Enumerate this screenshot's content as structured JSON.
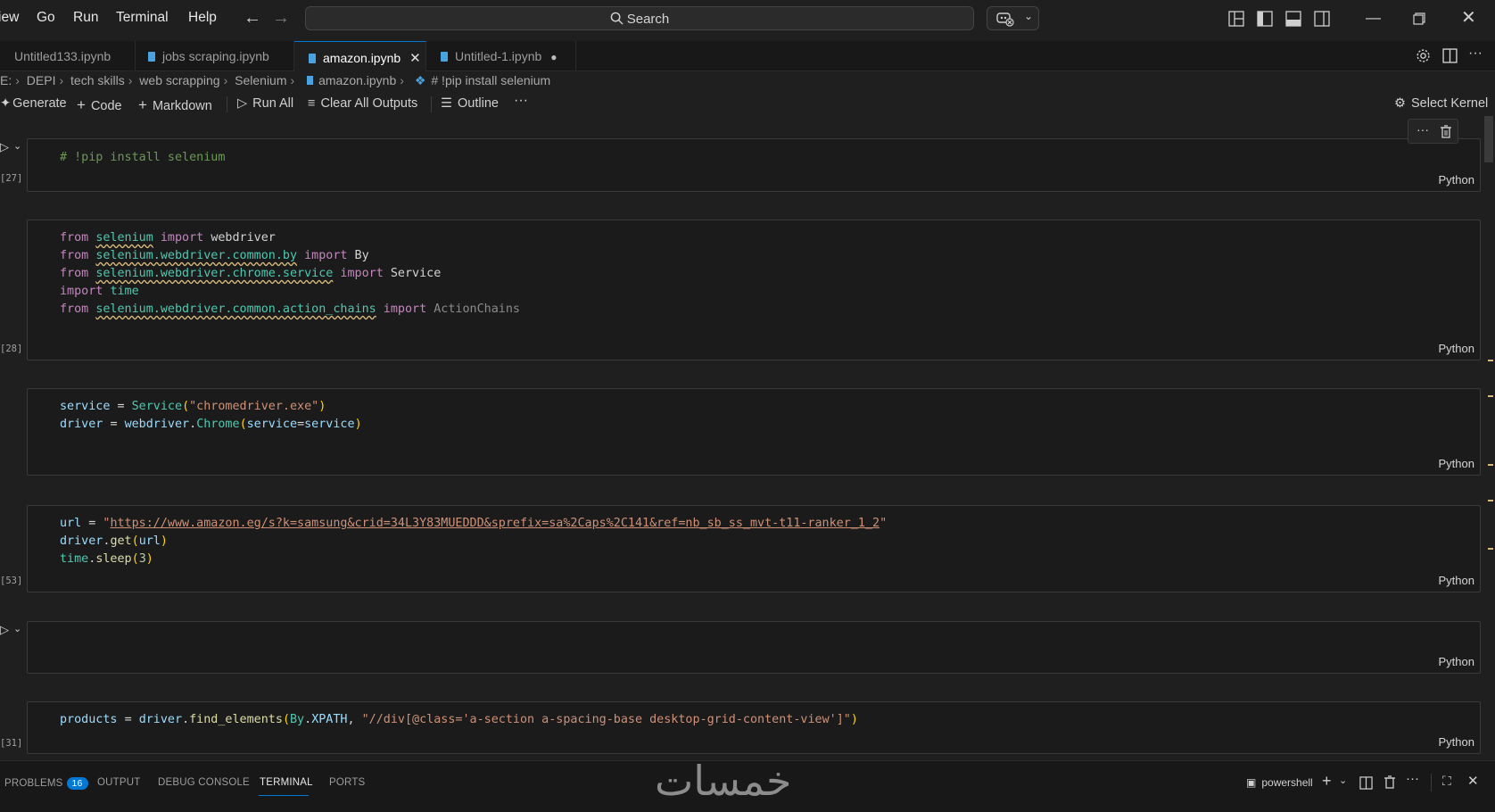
{
  "menu": [
    "iew",
    "Go",
    "Run",
    "Terminal",
    "Help"
  ],
  "search": {
    "label": "Search"
  },
  "tabs": [
    {
      "label": "Untitled133.ipynb",
      "active": false,
      "modified": false
    },
    {
      "label": "jobs scraping.ipynb",
      "active": false,
      "modified": false
    },
    {
      "label": "amazon.ipynb",
      "active": true,
      "modified": false
    },
    {
      "label": "Untitled-1.ipynb",
      "active": false,
      "modified": true
    }
  ],
  "breadcrumb": [
    "E:",
    "DEPI",
    "tech skills",
    "web scrapping",
    "Selenium",
    "amazon.ipynb",
    "# !pip install selenium"
  ],
  "notebook_toolbar": {
    "generate": "Generate",
    "code": "Code",
    "markdown": "Markdown",
    "run_all": "Run All",
    "clear_all": "Clear All Outputs",
    "outline": "Outline",
    "more": "···",
    "select_kernel": "Select Kernel"
  },
  "cells": [
    {
      "exec": "[27]",
      "lang": "Python",
      "lines": [
        "# !pip install selenium"
      ]
    },
    {
      "exec": "[28]",
      "lang": "Python",
      "lines": [
        "from selenium import webdriver",
        "from selenium.webdriver.common.by import By",
        "from selenium.webdriver.chrome.service import Service",
        "import time",
        "from selenium.webdriver.common.action_chains import ActionChains"
      ]
    },
    {
      "exec": "",
      "lang": "Python",
      "lines": [
        "service = Service(\"chromedriver.exe\")",
        "driver = webdriver.Chrome(service=service)"
      ]
    },
    {
      "exec": "[53]",
      "lang": "Python",
      "lines": [
        "url = \"https://www.amazon.eg/s?k=samsung&crid=34L3Y83MUEDDD&sprefix=sa%2Caps%2C141&ref=nb_sb_ss_mvt-t11-ranker_1_2\"",
        "driver.get(url)",
        "time.sleep(3)"
      ]
    },
    {
      "exec": "",
      "lang": "Python",
      "lines": []
    },
    {
      "exec": "[31]",
      "lang": "Python",
      "lines": [
        "products = driver.find_elements(By.XPATH, \"//div[@class='a-section a-spacing-base desktop-grid-content-view']\")"
      ]
    }
  ],
  "panel": {
    "tabs": [
      "PROBLEMS",
      "OUTPUT",
      "DEBUG CONSOLE",
      "TERMINAL",
      "PORTS"
    ],
    "problems_count": "16",
    "active_tab": "TERMINAL",
    "terminal_name": "powershell"
  },
  "watermark": "خمسات",
  "colors": {
    "accent": "#0078d4",
    "background": "#1f1f1f",
    "keyword": "#c586c0",
    "string": "#ce9178"
  }
}
